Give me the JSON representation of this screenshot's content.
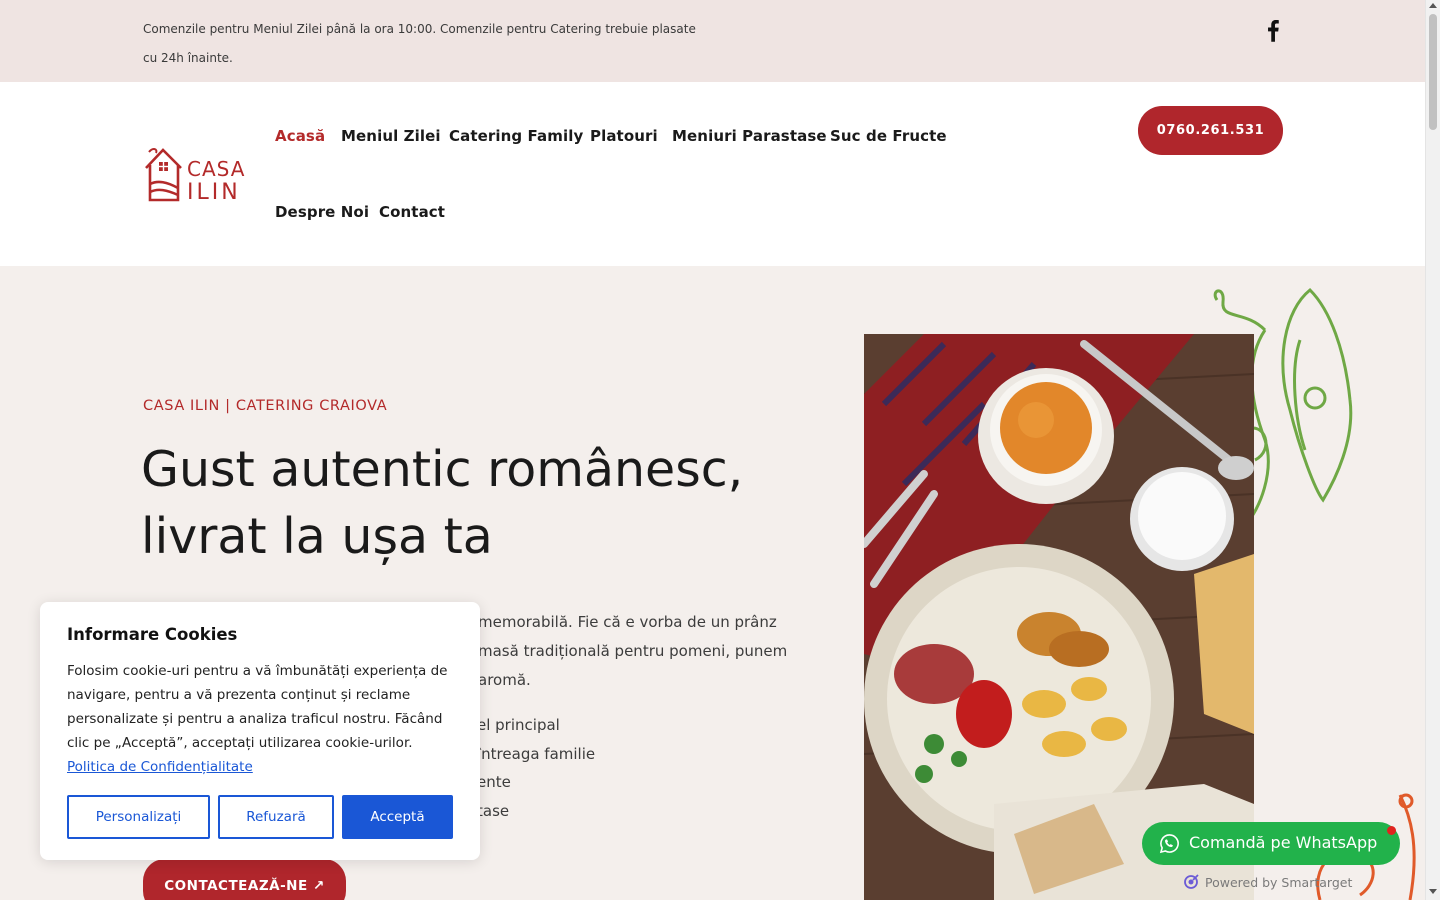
{
  "topbar": {
    "notice": "Comenzile pentru Meniul Zilei până la ora 10:00. Comenzile pentru Catering trebuie plasate cu 24h înainte.",
    "social_icon": "facebook-icon"
  },
  "header": {
    "logo_text_line1": "CASA",
    "logo_text_line2": "ILIN",
    "nav": [
      {
        "label": "Acasă",
        "active": true
      },
      {
        "label": "Meniul Zilei"
      },
      {
        "label": "Catering Family"
      },
      {
        "label": "Platouri"
      },
      {
        "label": "Meniuri Parastase"
      },
      {
        "label": "Suc de Fructe"
      },
      {
        "label": "Despre Noi"
      },
      {
        "label": "Contact"
      }
    ],
    "phone": "0760.261.531"
  },
  "hero": {
    "eyebrow": "CASA ILIN | CATERING CRAIOVA",
    "title": "Gust autentic românesc, livrat la ușa ta",
    "paragraph": "memorabilă. Fie că e vorba de un prânz masă tradițională pentru pomeni, punem aromă.",
    "list": [
      "el principal",
      " întreaga familie",
      "ente",
      "tase"
    ],
    "cta": "CONTACTEAZĂ-NE ↗"
  },
  "cookie": {
    "title": "Informare Cookies",
    "text": "Folosim cookie-uri pentru a vă îmbunătăți experiența de navigare, pentru a vă prezenta conținut și reclame personalizate și pentru a analiza traficul nostru. Făcând clic pe „Acceptă”, acceptați utilizarea cookie-urilor.",
    "link": "Politica de Confidențialitate",
    "buttons": {
      "customize": "Personalizați",
      "reject": "Refuzară",
      "accept": "Acceptă"
    }
  },
  "whatsapp": {
    "label": "Comandă pe WhatsApp",
    "powered": "Powered by Smartarget"
  },
  "colors": {
    "brand_red": "#b0262c",
    "cookie_blue": "#1a57d6",
    "whatsapp_green": "#22b24b",
    "topbar_bg": "#efe4e2",
    "hero_bg": "#f4efec"
  }
}
